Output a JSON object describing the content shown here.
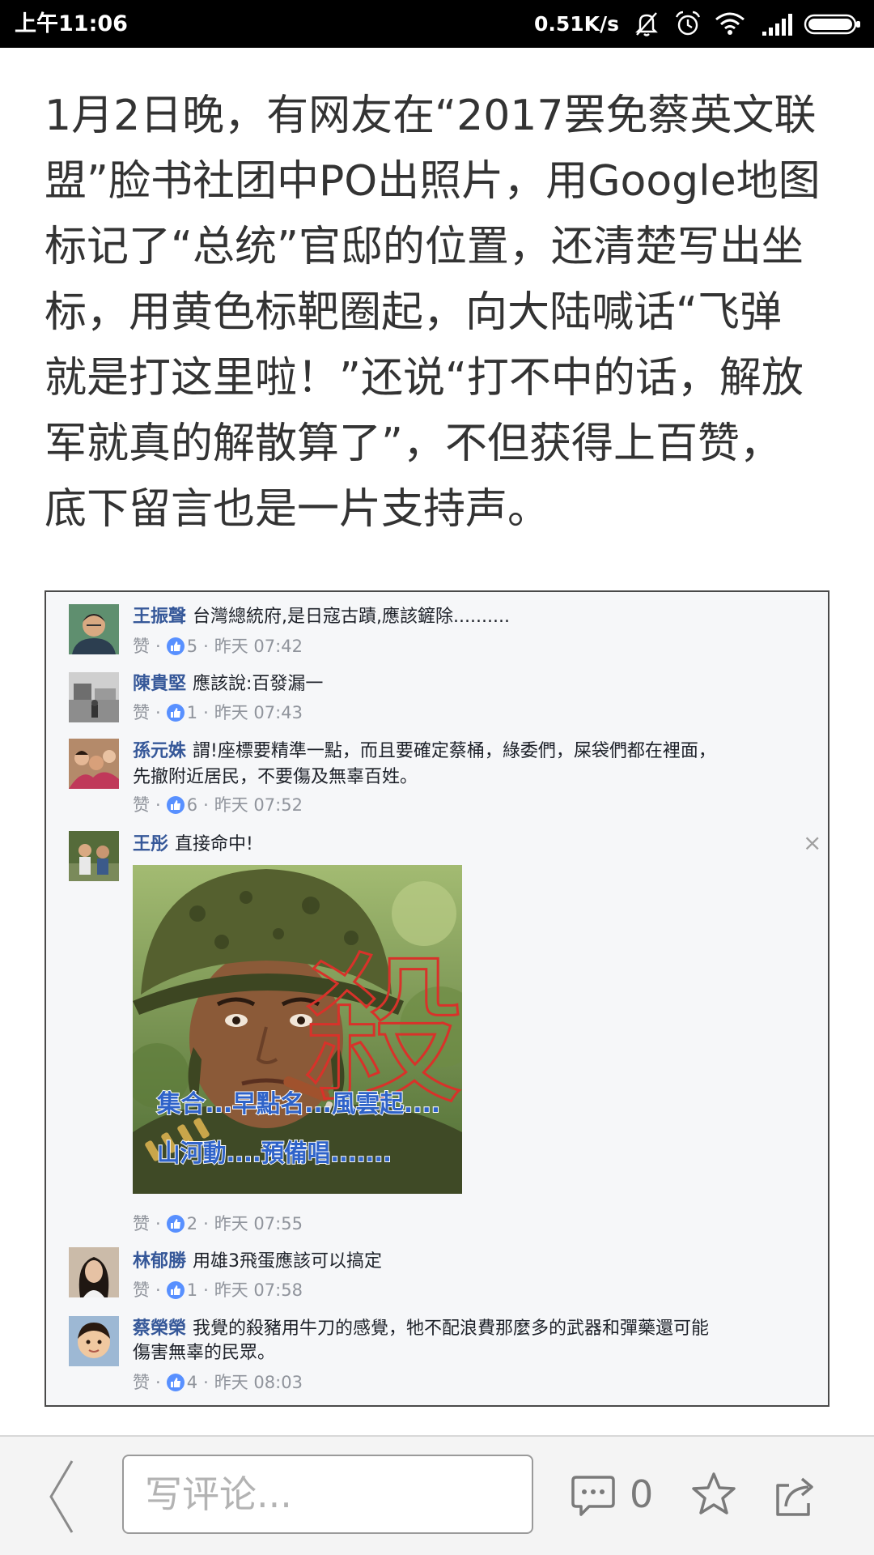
{
  "status_bar": {
    "time": "上午11:06",
    "net_speed": "0.51K/s",
    "icons": [
      "mute-icon",
      "alarm-icon",
      "wifi-icon",
      "signal-icon",
      "battery-icon"
    ]
  },
  "article": {
    "lines": [
      "1月2日晚，有网友在“2017罢免蔡英文联",
      "盟”脸书社团中PO出照片，用Google地图",
      "标记了“总统”官邸的位置，还清楚写出坐",
      "标，用黄色标靶圈起，向大陆喊话“飞弹",
      "就是打这里啦！”还说“打不中的话，解放",
      "军就真的解散算了”，不但获得上百赞，",
      "底下留言也是一片支持声。"
    ]
  },
  "embedded_screenshot": {
    "like_label": "赞",
    "separator": "·",
    "close_glyph": "×",
    "comments": [
      {
        "name": "王振聲",
        "lines": [
          "台灣總統府,是日寇古蹟,應該鏟除.........."
        ],
        "likes": "5",
        "time": "昨天 07:42"
      },
      {
        "name": "陳貴堅",
        "lines": [
          "應該說:百發漏一"
        ],
        "likes": "1",
        "time": "昨天 07:43"
      },
      {
        "name": "孫元姝",
        "lines": [
          "謂!座標要精準一點，而且要確定蔡桶，綠委們，屎袋們都在裡面，",
          "先撤附近居民，不要傷及無辜百姓。"
        ],
        "likes": "6",
        "time": "昨天 07:52"
      },
      {
        "name": "王彤",
        "lines": [
          "直接命中!"
        ],
        "likes": "2",
        "time": "昨天 07:55"
      },
      {
        "name": "林郁勝",
        "lines": [
          "用雄3飛蛋應該可以搞定"
        ],
        "likes": "1",
        "time": "昨天 07:58"
      },
      {
        "name": "蔡榮榮",
        "lines": [
          "我覺的殺豬用牛刀的感覺，牠不配浪費那麼多的武器和彈藥還可能",
          "傷害無辜的民眾。"
        ],
        "likes": "4",
        "time": "昨天 08:03"
      }
    ],
    "meme": {
      "stamp": "殺",
      "caption_lines": [
        "集合...早點名...風雲起....",
        "山河動....預備唱......."
      ]
    }
  },
  "bottom_bar": {
    "back_icon": "chevron-left-icon",
    "comment_placeholder": "写评论...",
    "comment_icon": "comment-icon",
    "comment_count": "0",
    "favorite_icon": "star-icon",
    "share_icon": "share-icon"
  },
  "colors": {
    "name_blue": "#365899",
    "like_blue": "#5890ff",
    "meta_gray": "#90949c",
    "stamp_red": "#d8322a",
    "caption_blue": "#2f63c9"
  }
}
